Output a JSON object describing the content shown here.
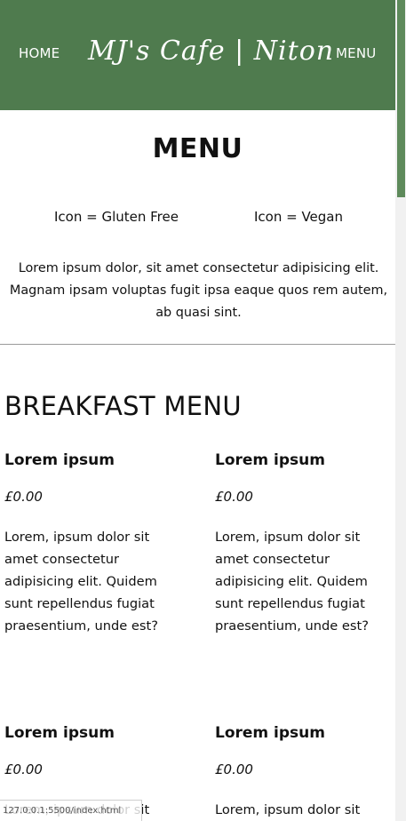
{
  "header": {
    "nav_home": "HOME",
    "site_title": "MJ's Cafe | Niton",
    "nav_menu": "MENU"
  },
  "main": {
    "title": "MENU",
    "legend": {
      "gluten_free": "Icon = Gluten Free",
      "vegan": "Icon = Vegan"
    },
    "intro": "Lorem ipsum dolor, sit amet consectetur adipisicing elit. Magnam ipsam voluptas fugit ipsa eaque quos rem autem, ab quasi sint."
  },
  "breakfast": {
    "title": "BREAKFAST MENU",
    "items": [
      {
        "name": "Lorem ipsum",
        "price": "£0.00",
        "description": "Lorem, ipsum dolor sit amet consectetur adipisicing elit. Quidem sunt repellendus fugiat praesentium, unde est?"
      },
      {
        "name": "Lorem ipsum",
        "price": "£0.00",
        "description": "Lorem, ipsum dolor sit amet consectetur adipisicing elit. Quidem sunt repellendus fugiat praesentium, unde est?"
      },
      {
        "name": "Lorem ipsum",
        "price": "£0.00",
        "description": "Lorem, ipsum dolor sit"
      },
      {
        "name": "Lorem ipsum",
        "price": "£0.00",
        "description": "Lorem, ipsum dolor sit"
      }
    ]
  },
  "status_bar": {
    "url": "127.0.0.1:5500/index.html"
  },
  "colors": {
    "header_bg": "#4f7b4e",
    "scroll_thumb": "#5e8a5b"
  }
}
